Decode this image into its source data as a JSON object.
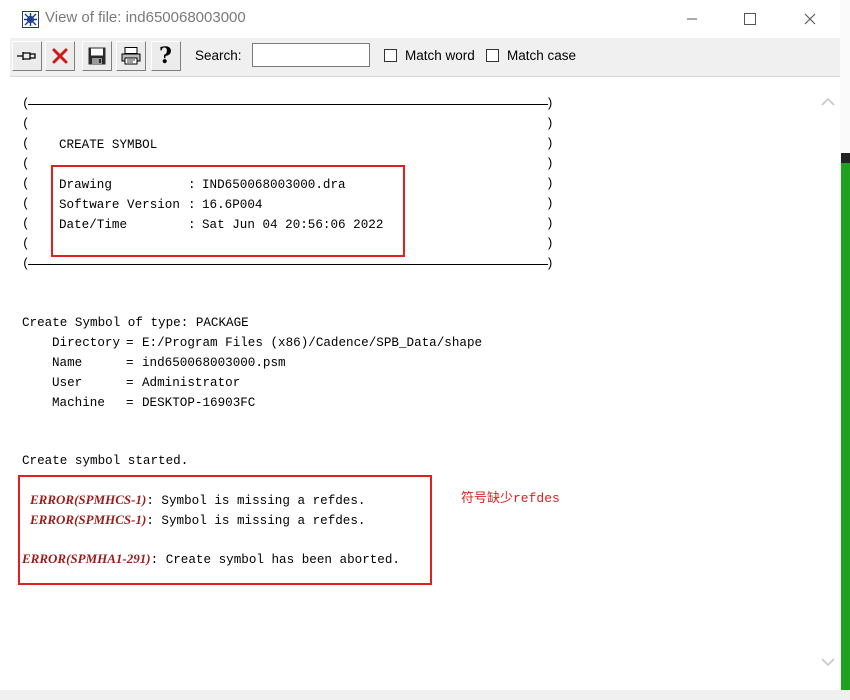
{
  "window": {
    "title": "View of file: ind650068003000",
    "minimize_label": "—",
    "maximize_label": "☐",
    "close_label": "✕"
  },
  "toolbar": {
    "search_label": "Search:",
    "search_value": "",
    "match_word_label": "Match word",
    "match_word_checked": false,
    "match_case_label": "Match case",
    "match_case_checked": false
  },
  "log": {
    "header_title": "CREATE SYMBOL",
    "info": [
      {
        "key": "Drawing",
        "sep": ":",
        "value": "IND650068003000.dra"
      },
      {
        "key": "Software Version",
        "sep": ":",
        "value": "16.6P004"
      },
      {
        "key": "Date/Time",
        "sep": ":",
        "value": "Sat Jun 04 20:56:06 2022"
      }
    ],
    "create_line": "Create Symbol of type: PACKAGE",
    "details": [
      {
        "key": "Directory",
        "value": "E:/Program Files (x86)/Cadence/SPB_Data/shape"
      },
      {
        "key": "Name",
        "value": "ind650068003000.psm"
      },
      {
        "key": "User",
        "value": "Administrator"
      },
      {
        "key": "Machine",
        "value": "DESKTOP-16903FC"
      }
    ],
    "started_line": "Create symbol started.",
    "errors": [
      {
        "code": "ERROR(SPMHCS-1)",
        "message": ": Symbol is missing a refdes."
      },
      {
        "code": "ERROR(SPMHCS-1)",
        "message": ": Symbol is missing a refdes."
      },
      {
        "code": "ERROR(SPMHA1-291)",
        "message": ": Create symbol has been aborted."
      }
    ]
  },
  "annotation": {
    "text": "符号缺少refdes",
    "color": "#e02020"
  }
}
